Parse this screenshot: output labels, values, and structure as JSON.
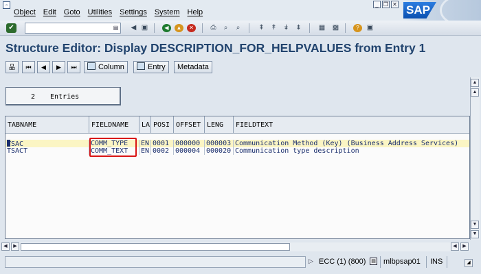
{
  "menu": [
    "Object",
    "Edit",
    "Goto",
    "Utilities",
    "Settings",
    "System",
    "Help"
  ],
  "window_controls": [
    "minimize-icon",
    "restore-icon",
    "close-icon"
  ],
  "logo_text": "SAP",
  "toolbar": {
    "command_value": "",
    "icons": [
      "enter-icon",
      "back-icon",
      "exit-icon",
      "cancel-icon",
      "print-icon",
      "find-icon",
      "find-next-icon",
      "first-page-icon",
      "previous-page-icon",
      "next-page-icon",
      "last-page-icon",
      "new-session-icon",
      "shortcut-icon",
      "help-icon",
      "customize-layout-icon"
    ]
  },
  "title": "Structure Editor: Display DESCRIPTION_FOR_HELPVALUES from Entry 1",
  "app_toolbar": {
    "column_label": "Column",
    "entry_label": "Entry",
    "metadata_label": "Metadata"
  },
  "entries": {
    "count": "2",
    "label": "Entries"
  },
  "grid": {
    "columns": [
      "TABNAME",
      "FIELDNAME",
      "LA",
      "POSI",
      "OFFSET",
      "LENG",
      "FIELDTEXT"
    ],
    "rows": [
      [
        "TSAC",
        "COMM_TYPE",
        "EN",
        "0001",
        "000000",
        "000003",
        "Communication Method (Key) (Business Address Services)"
      ],
      [
        "TSACT",
        "COMM_TEXT",
        "EN",
        "0002",
        "000004",
        "000020",
        "Communication type description"
      ]
    ]
  },
  "status": {
    "system": "ECC (1) (800)",
    "host": "mlbpsap01",
    "mode": "INS"
  },
  "colors": {
    "title": "#23456f",
    "highlight_row": "#fbf5c4",
    "red_box": "#d91414"
  }
}
